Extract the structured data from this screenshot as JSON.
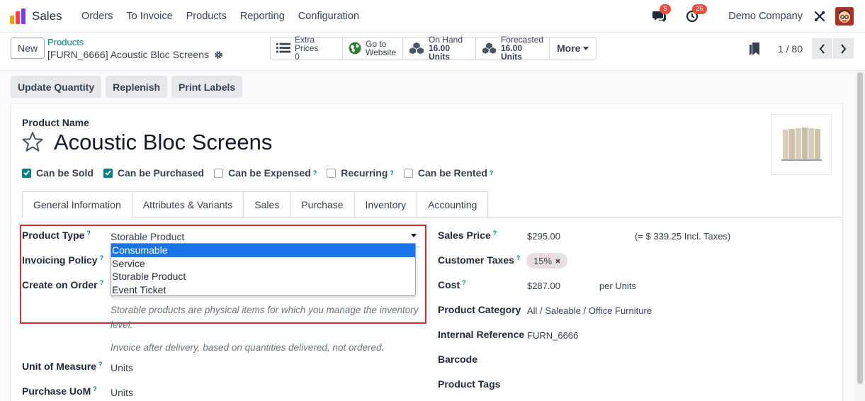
{
  "navbar": {
    "app_name": "Sales",
    "menu": [
      "Orders",
      "To Invoice",
      "Products",
      "Reporting",
      "Configuration"
    ],
    "chat_count": "5",
    "activity_count": "26",
    "company": "Demo Company"
  },
  "control": {
    "new_label": "New",
    "breadcrumb_parent": "Products",
    "breadcrumb_current": "[FURN_6666] Acoustic Bloc Screens",
    "smart_buttons": {
      "extra_prices_label": "Extra Prices",
      "extra_prices_value": "0",
      "website_line1": "Go to",
      "website_line2": "Website",
      "on_hand_label": "On Hand",
      "on_hand_value": "16.00 Units",
      "forecasted_label": "Forecasted",
      "forecasted_value": "16.00 Units",
      "more_label": "More"
    },
    "pager": "1 / 80"
  },
  "actions": [
    "Update Quantity",
    "Replenish",
    "Print Labels"
  ],
  "product": {
    "name_label": "Product Name",
    "name": "Acoustic Bloc Screens",
    "checkboxes": [
      {
        "label": "Can be Sold",
        "checked": true,
        "help": ""
      },
      {
        "label": "Can be Purchased",
        "checked": true,
        "help": ""
      },
      {
        "label": "Can be Expensed",
        "checked": false,
        "help": "?"
      },
      {
        "label": "Recurring",
        "checked": false,
        "help": "?"
      },
      {
        "label": "Can be Rented",
        "checked": false,
        "help": "?"
      }
    ]
  },
  "tabs": [
    "General Information",
    "Attributes & Variants",
    "Sales",
    "Purchase",
    "Inventory",
    "Accounting"
  ],
  "left_fields": {
    "product_type_label": "Product Type",
    "product_type_value": "Storable Product",
    "invoicing_policy_label": "Invoicing Policy",
    "create_on_order_label": "Create on Order",
    "type_help_line1": "Storable products are physical items for which you manage the inventory",
    "type_help_line2": "level.",
    "invoice_help": "Invoice after delivery, based on quantities delivered, not ordered.",
    "uom_label": "Unit of Measure",
    "uom_value": "Units",
    "purchase_uom_label": "Purchase UoM",
    "purchase_uom_value": "Units"
  },
  "dropdown": {
    "options": [
      "Consumable",
      "Service",
      "Storable Product",
      "Event Ticket"
    ],
    "highlighted": "Consumable"
  },
  "right_fields": {
    "sales_price_label": "Sales Price",
    "sales_price_value": "$295.00",
    "sales_price_incl": "(= $ 339.25 Incl. Taxes)",
    "customer_taxes_label": "Customer Taxes",
    "customer_taxes_value": "15%",
    "cost_label": "Cost",
    "cost_value": "$287.00",
    "cost_unit": "per Units",
    "category_label": "Product Category",
    "category_value": "All / Saleable / Office Furniture",
    "internal_ref_label": "Internal Reference",
    "internal_ref_value": "FURN_6666",
    "barcode_label": "Barcode",
    "tags_label": "Product Tags"
  },
  "colors": {
    "brand_teal": "#017e84",
    "highlight_red": "#d32f2f",
    "dropdown_selection": "#1a73e8",
    "badge_red": "#e74c3c"
  }
}
